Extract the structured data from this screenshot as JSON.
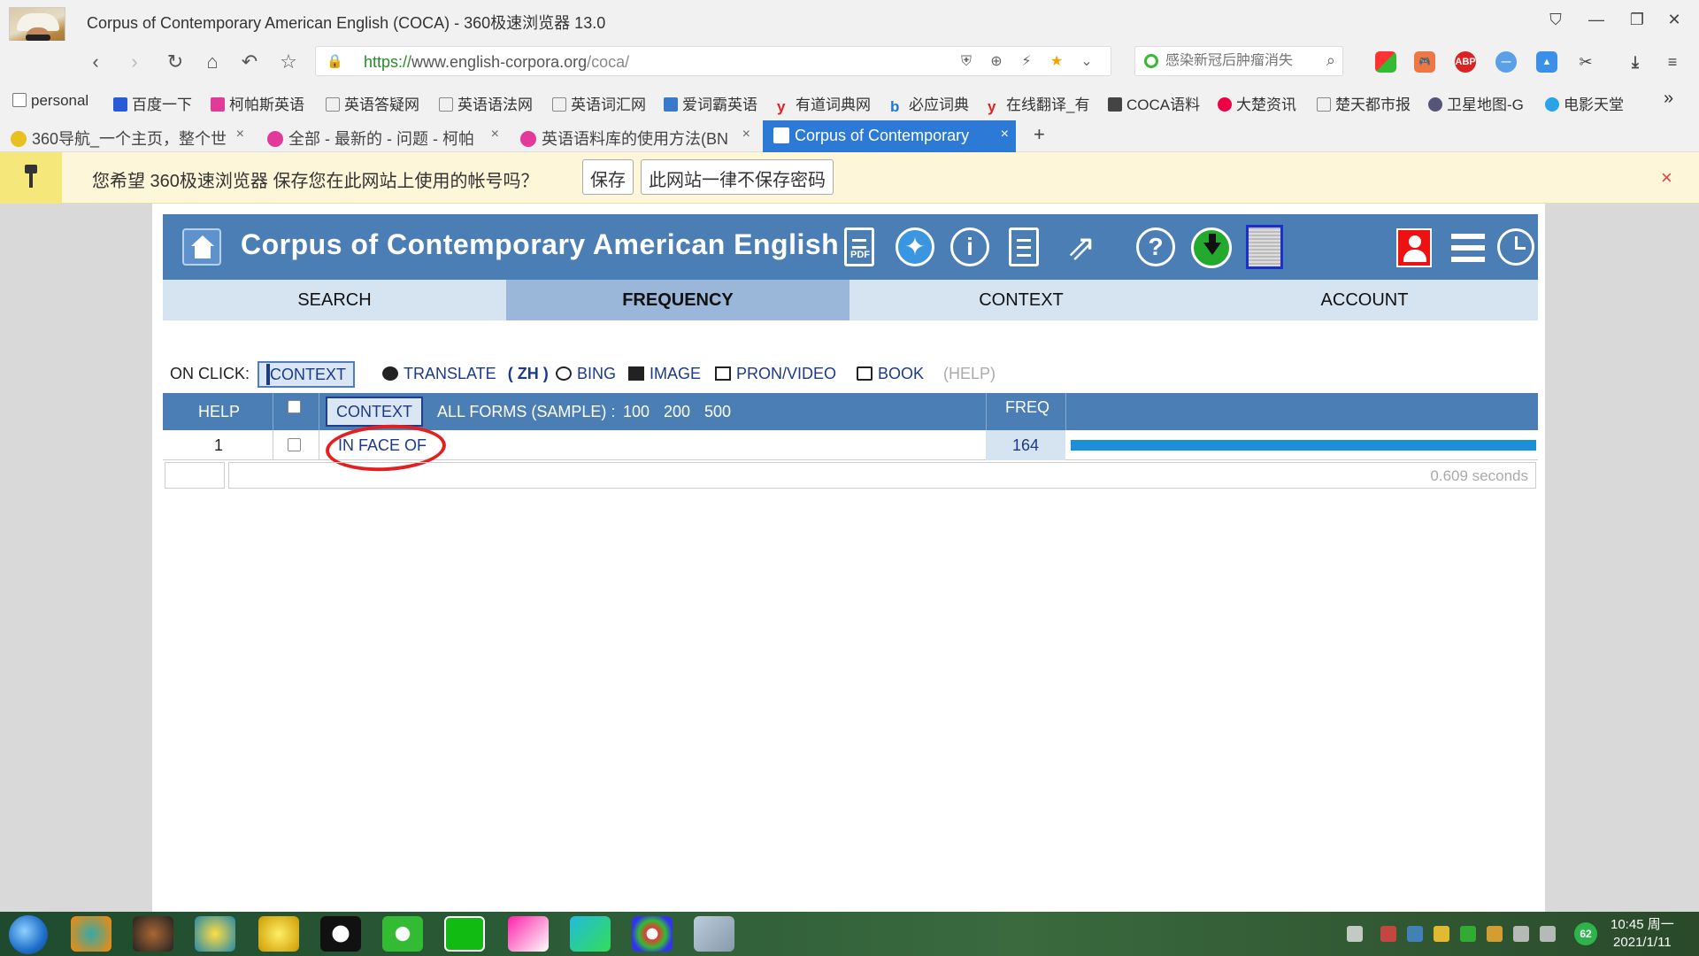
{
  "window": {
    "title": "Corpus of Contemporary American English (COCA) - 360极速浏览器 13.0"
  },
  "nav": {
    "url_scheme": "https://",
    "url_host": "www.english-corpora.org",
    "url_path": "/coca/",
    "search_placeholder": "感染新冠后肿瘤消失"
  },
  "bookmarks": [
    {
      "label": "personal",
      "icon": "folder-icon"
    },
    {
      "label": "百度一下",
      "icon": "baidu-icon"
    },
    {
      "label": "柯帕斯英语",
      "icon": "kps-icon"
    },
    {
      "label": "英语答疑网",
      "icon": "page-icon"
    },
    {
      "label": "英语语法网",
      "icon": "page-icon"
    },
    {
      "label": "英语词汇网",
      "icon": "page-icon"
    },
    {
      "label": "爱词霸英语",
      "icon": "iciba-icon"
    },
    {
      "label": "有道词典网",
      "icon": "youdao-icon"
    },
    {
      "label": "必应词典",
      "icon": "bing-icon"
    },
    {
      "label": "在线翻译_有",
      "icon": "youdao-icon"
    },
    {
      "label": "COCA语料",
      "icon": "coca-icon"
    },
    {
      "label": "大楚资讯",
      "icon": "dachu-icon"
    },
    {
      "label": "楚天都市报",
      "icon": "page-icon"
    },
    {
      "label": "卫星地图-G",
      "icon": "globe-icon"
    },
    {
      "label": "电影天堂",
      "icon": "heart-icon"
    }
  ],
  "bookmarks_more": "»",
  "tabs": [
    {
      "label": "360导航_一个主页，整个世",
      "close": "×"
    },
    {
      "label": "全部 - 最新的 - 问题 - 柯帕",
      "close": "×"
    },
    {
      "label": "英语语料库的使用方法(BN",
      "close": "×"
    },
    {
      "label": "Corpus of Contemporary",
      "close": "×"
    }
  ],
  "new_tab": "+",
  "infobar": {
    "text": "您希望 360极速浏览器 保存您在此网站上使用的帐号吗？",
    "save": "保存",
    "never": "此网站一律不保存密码",
    "close": "×"
  },
  "coca": {
    "site_title": "Corpus of Contemporary American English",
    "pdf_label": "PDF",
    "tabs": [
      "SEARCH",
      "FREQUENCY",
      "CONTEXT",
      "ACCOUNT"
    ],
    "active_tab": "FREQUENCY",
    "on_click": {
      "label": "ON CLICK:",
      "context": "CONTEXT",
      "translate": "TRANSLATE",
      "translate_lang": "( ZH )",
      "bing": "BING",
      "image": "IMAGE",
      "pron": "PRON/VIDEO",
      "book": "BOOK",
      "help": "(HELP)"
    },
    "table": {
      "help_col": "HELP",
      "context_btn": "CONTEXT",
      "all_forms": "ALL FORMS",
      "sample": "(SAMPLE) :",
      "sample_sizes": [
        "100",
        "200",
        "500"
      ],
      "freq_col": "FREQ",
      "rows": [
        {
          "index": "1",
          "word": "IN FACE OF",
          "freq": "164",
          "bar_fraction": 1.0
        }
      ],
      "time": "0.609 seconds"
    }
  },
  "taskbar": {
    "battery": "62",
    "time": "10:45 周一",
    "date": "2021/1/11"
  },
  "colors": {
    "coca_blue": "#4c7eb6",
    "tab_active": "#2c7ad6",
    "annotation_red": "#e51f1f",
    "freq_bar": "#1b8fd8"
  }
}
